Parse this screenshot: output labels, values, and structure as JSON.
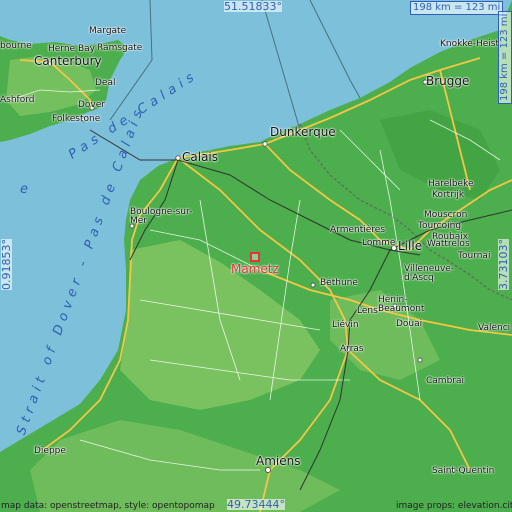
{
  "map": {
    "highlight_place": "Mametz",
    "colors": {
      "sea": "#7cc0da",
      "land": "#4cae4c",
      "land_light": "#8fca6a",
      "road_major": "#f3c745",
      "road_minor": "#ffffff",
      "rail": "#333333",
      "border": "#555555",
      "highlight": "#e8323a",
      "coord_text": "#2f5fb3"
    },
    "coords": {
      "top": "51.51833°",
      "bottom": "49.73444°",
      "left": "0.91853°",
      "right": "3.73103°"
    },
    "scale": {
      "horizontal": "198 km = 123 mi",
      "vertical": "198 km = 123 mi"
    },
    "sea_labels": {
      "pas_de_calais": "Pas de Calais",
      "strait_of_dover": "Strait of Dover - Pas de Calais",
      "e": "e"
    },
    "attribution_left": "map data: openstreetmap, style: opentopomap",
    "attribution_right": "image props: elevation.city",
    "places": {
      "margate": "Margate",
      "herne_bay": "Herne Bay",
      "ramsgate": "Ramsgate",
      "bourne": "bourne",
      "canterbury": "Canterbury",
      "deal": "Deal",
      "ashford": "Ashford",
      "dover": "Dover",
      "folkestone": "Folkestone",
      "knokke": "Knokke-Heist",
      "brugge": "Brugge",
      "dunkerque": "Dunkerque",
      "calais": "Calais",
      "boulogne": "Boulogne-sur-\nMer",
      "harelbeke": "Harelbeke",
      "kortrijk": "Kortrijk",
      "mouscron": "Mouscron",
      "tourcoing": "Tourcoing",
      "armentieres": "Armentières",
      "roubaix": "Roubaix",
      "lomme": "Lomme",
      "lille": "Lille",
      "wattrelos": "Wattrelos",
      "tournai": "Tournai",
      "villeneuve": "Villeneuve-\nd'Ascq",
      "bethune": "Béthune",
      "henin": "Hénin-\nBeaumont",
      "lens": "Lens",
      "lievin": "Liévin",
      "douai": "Douai",
      "valenciennes": "Valenci",
      "arras": "Arras",
      "cambrai": "Cambrai",
      "dieppe": "Dieppe",
      "amiens": "Amiens",
      "saint_quentin": "Saint-Quentin"
    }
  }
}
